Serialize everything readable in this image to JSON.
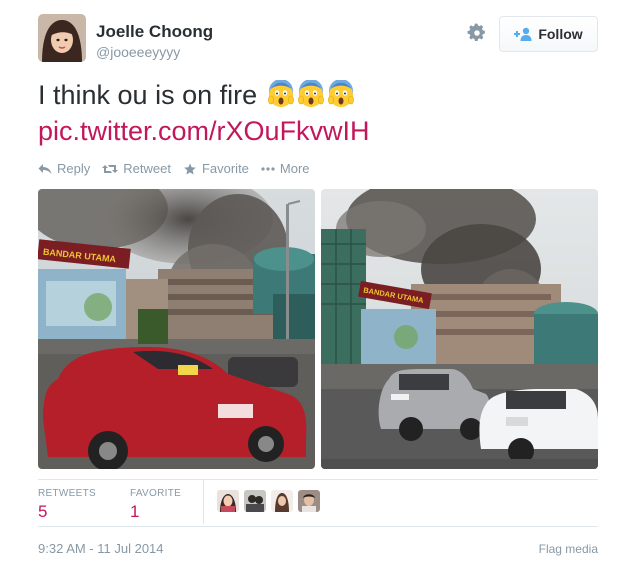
{
  "user": {
    "full_name": "Joelle Choong",
    "screen_name": "@jooeeeyyyy",
    "avatar_icon": "user-avatar"
  },
  "header": {
    "settings_icon": "gear-icon",
    "follow_label": "Follow",
    "follow_icon": "add-user-icon"
  },
  "tweet": {
    "text": "I think ou is on fire",
    "emojis": [
      "face-screaming-in-fear",
      "face-screaming-in-fear",
      "face-screaming-in-fear"
    ],
    "link": "pic.twitter.com/rXOuFkvwIH"
  },
  "actions": [
    {
      "label": "Reply",
      "icon": "reply-icon"
    },
    {
      "label": "Retweet",
      "icon": "retweet-icon"
    },
    {
      "label": "Favorite",
      "icon": "star-icon"
    },
    {
      "label": "More",
      "icon": "more-dots-icon"
    }
  ],
  "photos": {
    "left_sign": "BANDAR UTAMA",
    "right_sign": "BANDAR UTAMA"
  },
  "stats": {
    "retweets_label": "RETWEETS",
    "retweets_value": "5",
    "favorite_label": "FAVORITE",
    "favorite_value": "1"
  },
  "footer": {
    "timestamp": "9:32 AM - 11 Jul 2014",
    "flag_label": "Flag media"
  },
  "colors": {
    "link": "#c2185b",
    "muted": "#8899a6",
    "text": "#292f33",
    "border": "#e1e8ed"
  }
}
